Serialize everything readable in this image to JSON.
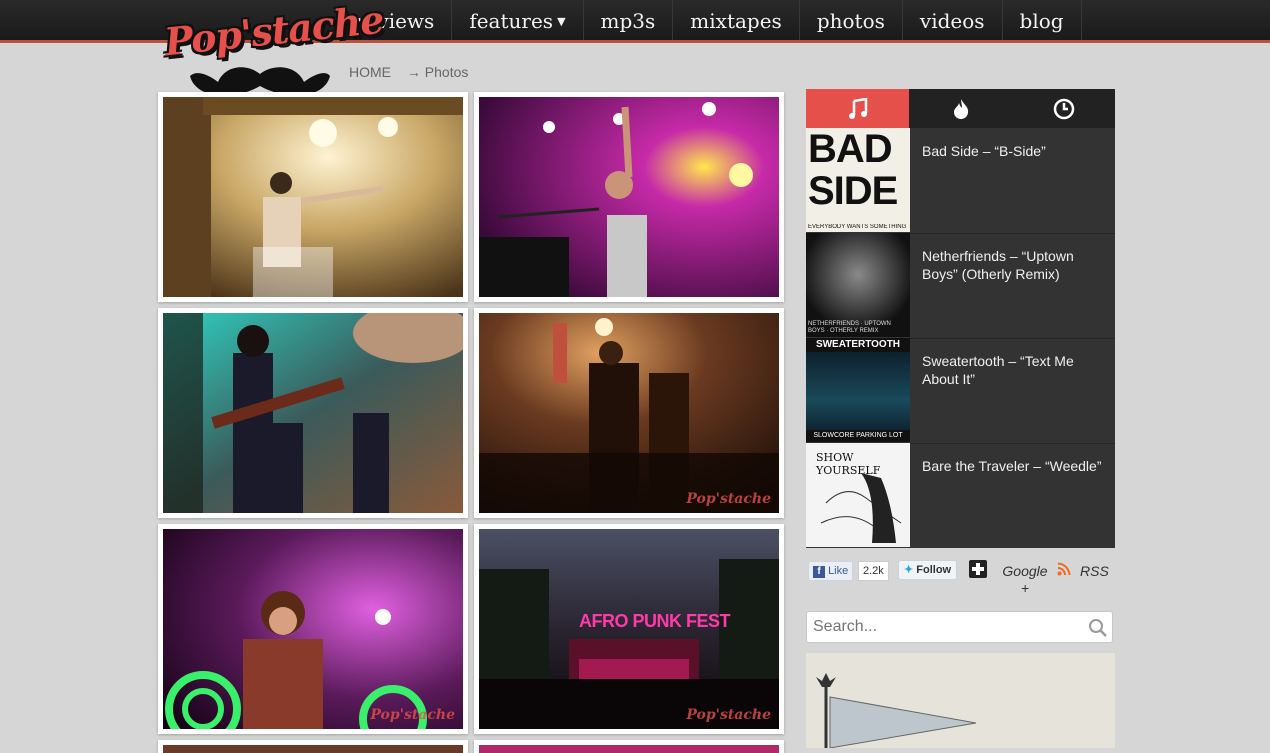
{
  "site": {
    "logo_text": "Pop'stache"
  },
  "nav": {
    "items": [
      {
        "label": "reviews",
        "caret": ""
      },
      {
        "label": "features",
        "caret": "▼"
      },
      {
        "label": "mp3s",
        "caret": ""
      },
      {
        "label": "mixtapes",
        "caret": ""
      },
      {
        "label": "photos",
        "caret": ""
      },
      {
        "label": "videos",
        "caret": ""
      },
      {
        "label": "blog",
        "caret": ""
      }
    ]
  },
  "breadcrumb": {
    "home": "HOME",
    "current": "→ Photos"
  },
  "photos": {
    "watermark": "Pop'stache",
    "afropunk_sign": "AFRO PUNK FEST"
  },
  "sidebar": {
    "tabs": [
      {
        "icon": "music-note-icon"
      },
      {
        "icon": "flame-icon"
      },
      {
        "icon": "clock-icon"
      }
    ],
    "tracks": [
      {
        "title": "Bad Side – “B-Side”",
        "art_text": "BAD SIDE",
        "art_caption": "EVERYBODY WANTS SOMETHING FROM ME"
      },
      {
        "title": "Netherfriends – “Uptown Boys” (Otherly Remix)",
        "art_caption": "NETHERFRIENDS · UPTOWN BOYS · OTHERLY REMIX"
      },
      {
        "title": "Sweatertooth – “Text Me About It”",
        "art_text": "SWEATERTOOTH",
        "art_caption": "SLOWCORE PARKING LOT"
      },
      {
        "title": "Bare the Traveler – “Weedle”",
        "art_text": "SHOW YOURSELF"
      }
    ]
  },
  "social": {
    "like_label": "Like",
    "like_count": "2.2k",
    "follow_label": "Follow",
    "google_label": "Google +",
    "rss_label": "RSS"
  },
  "search": {
    "placeholder": "Search..."
  },
  "colors": {
    "accent": "#e5504a",
    "nav_bg": "#1f1f1f",
    "sidebar_bg": "#333333"
  }
}
